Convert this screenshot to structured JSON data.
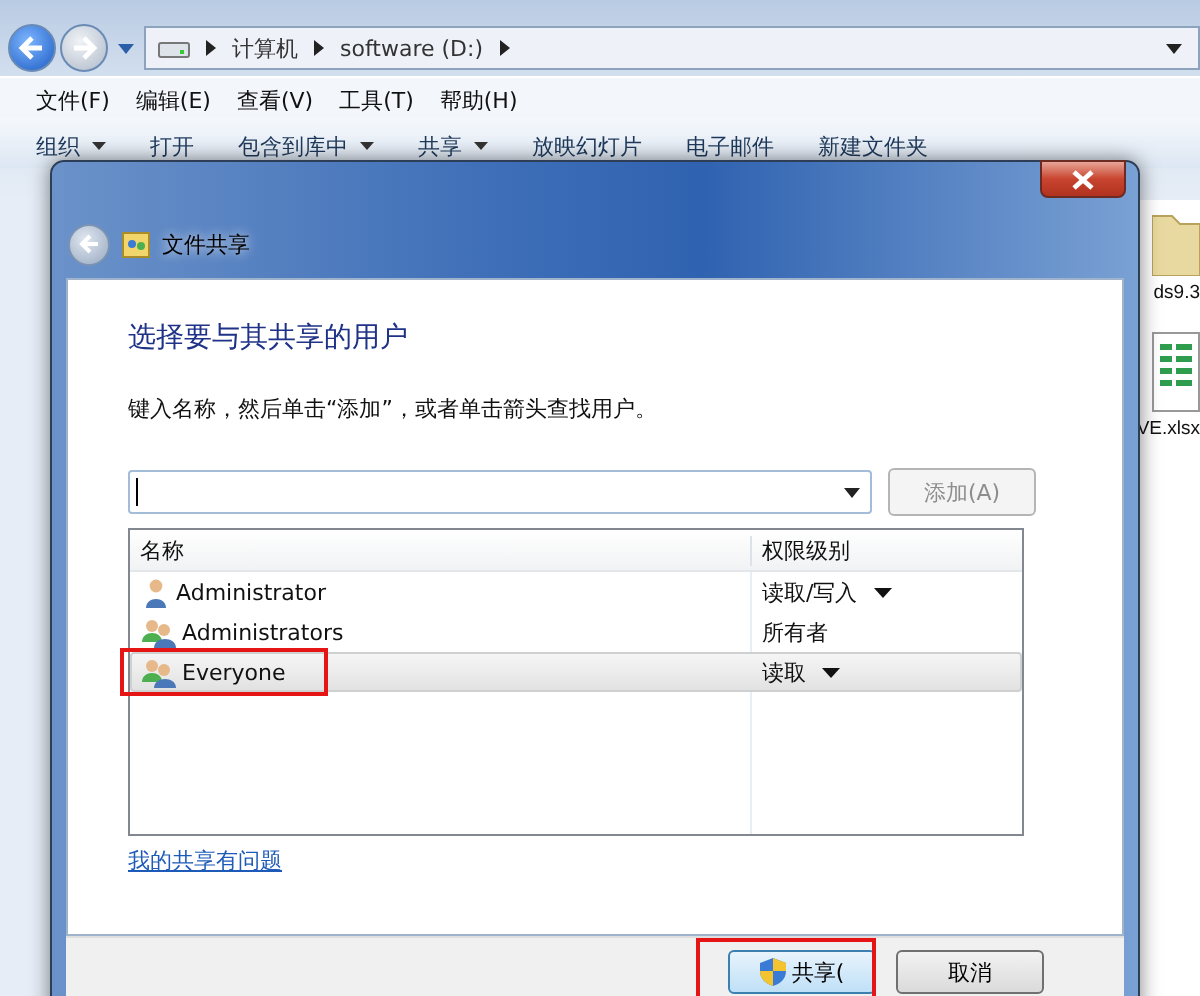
{
  "explorer": {
    "path": [
      "计算机",
      "software (D:)"
    ],
    "menu": [
      "文件(F)",
      "编辑(E)",
      "查看(V)",
      "工具(T)",
      "帮助(H)"
    ],
    "toolbar": [
      {
        "label": "组织",
        "dropdown": true
      },
      {
        "label": "打开",
        "dropdown": false
      },
      {
        "label": "包含到库中",
        "dropdown": true
      },
      {
        "label": "共享",
        "dropdown": true
      },
      {
        "label": "放映幻灯片",
        "dropdown": false
      },
      {
        "label": "电子邮件",
        "dropdown": false
      },
      {
        "label": "新建文件夹",
        "dropdown": false
      }
    ],
    "files": [
      {
        "kind": "folder",
        "name": "ds9.3"
      },
      {
        "kind": "sheet",
        "name": "VE.xlsx"
      }
    ]
  },
  "dialog": {
    "title": "文件共享",
    "heading": "选择要与其共享的用户",
    "instruction": "键入名称，然后单击“添加”，或者单击箭头查找用户。",
    "add_button": {
      "label": "添加(A)",
      "disabled": true
    },
    "columns": [
      "名称",
      "权限级别"
    ],
    "users": [
      {
        "kind": "user",
        "name": "Administrator",
        "permission": "读取/写入",
        "dropdown": true,
        "selected": false,
        "highlighted": false
      },
      {
        "kind": "group",
        "name": "Administrators",
        "permission": "所有者",
        "dropdown": false,
        "selected": false,
        "highlighted": false
      },
      {
        "kind": "group",
        "name": "Everyone",
        "permission": "读取",
        "dropdown": true,
        "selected": true,
        "highlighted": true
      }
    ],
    "help_link": "我的共享有问题",
    "share_button": {
      "label": "共享(",
      "highlighted": true
    },
    "cancel_button": "取消"
  }
}
